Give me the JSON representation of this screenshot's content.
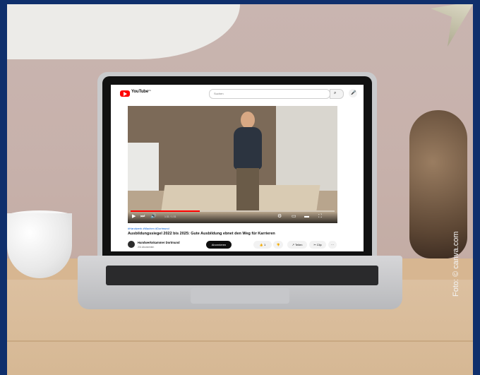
{
  "image": {
    "credit": "Foto: © canva.com"
  },
  "screen": {
    "youtube": {
      "brand": "YouTube",
      "region": "DE",
      "search": {
        "placeholder": "Suchen"
      },
      "video": {
        "progress_fraction": 0.34,
        "time_text": "1:31 / 1:31"
      },
      "hashtag": "#Handwerk #Machen #Dortmund",
      "title": "Ausbildungssiegel 2022 bis 2025: Gute Ausbildung ebnet den Weg für Karrieren",
      "channel": {
        "name": "Handwerkskammer Dortmund",
        "subscribers": "201 Abonnenten",
        "subscribe_label": "Abonnieren"
      },
      "actions": {
        "like": "1",
        "share": "Teilen",
        "clip": "Clip",
        "more": "···"
      }
    }
  },
  "colors": {
    "frame": "#0f2f6c",
    "youtube_red": "#ff0000"
  },
  "icons": [
    "youtube-logo-icon",
    "search-icon",
    "mic-icon",
    "play-icon",
    "next-icon",
    "volume-icon",
    "settings-icon",
    "fullscreen-icon",
    "like-icon",
    "dislike-icon",
    "share-icon",
    "clip-icon",
    "more-icon"
  ]
}
